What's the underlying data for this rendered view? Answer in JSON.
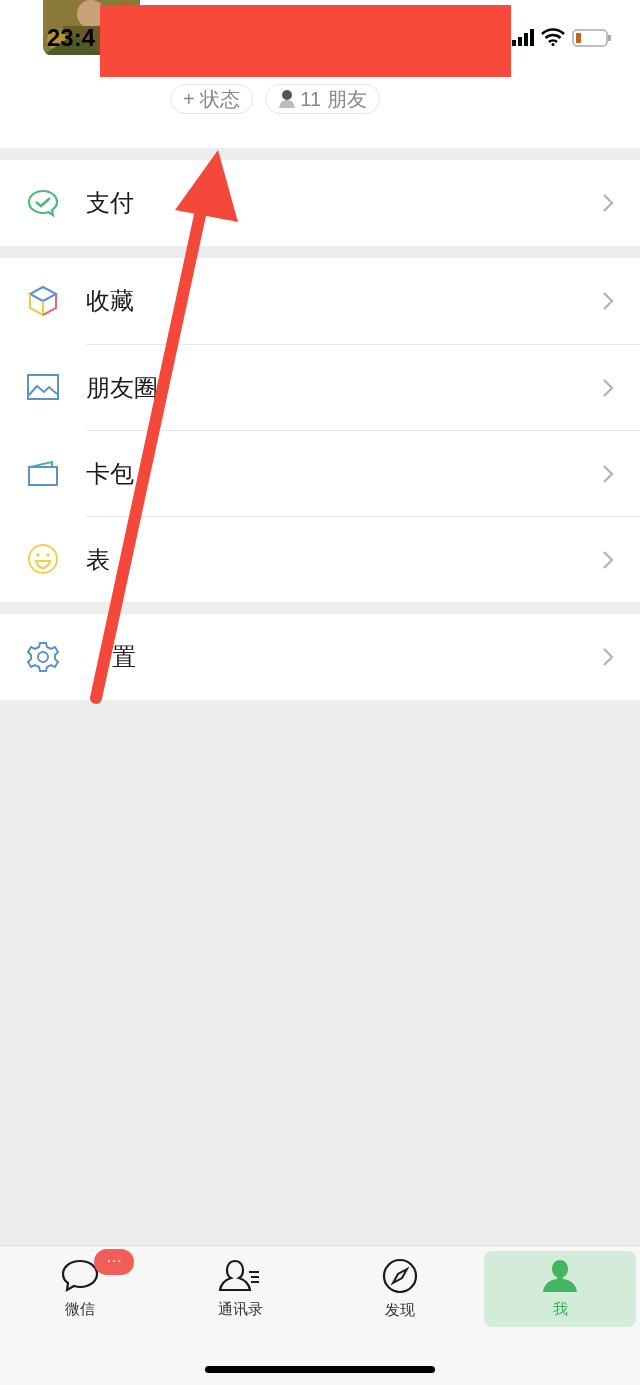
{
  "status_bar": {
    "time": "23:4"
  },
  "profile": {
    "pills": [
      {
        "kind": "status",
        "label": "+ 状态"
      },
      {
        "kind": "friends",
        "label": "11 朋友"
      }
    ]
  },
  "menu_groups": [
    [
      {
        "label": "支付"
      }
    ],
    [
      {
        "label": "收藏"
      },
      {
        "label": "朋友圈"
      },
      {
        "label": "卡包"
      },
      {
        "label": "表"
      }
    ],
    [
      {
        "label": "置",
        "first_char_hidden": true
      }
    ]
  ],
  "tabs": [
    {
      "label": "微信",
      "selected": false,
      "badge": "···"
    },
    {
      "label": "通讯录",
      "selected": false
    },
    {
      "label": "发现",
      "selected": false
    },
    {
      "label": "我",
      "selected": true
    }
  ]
}
